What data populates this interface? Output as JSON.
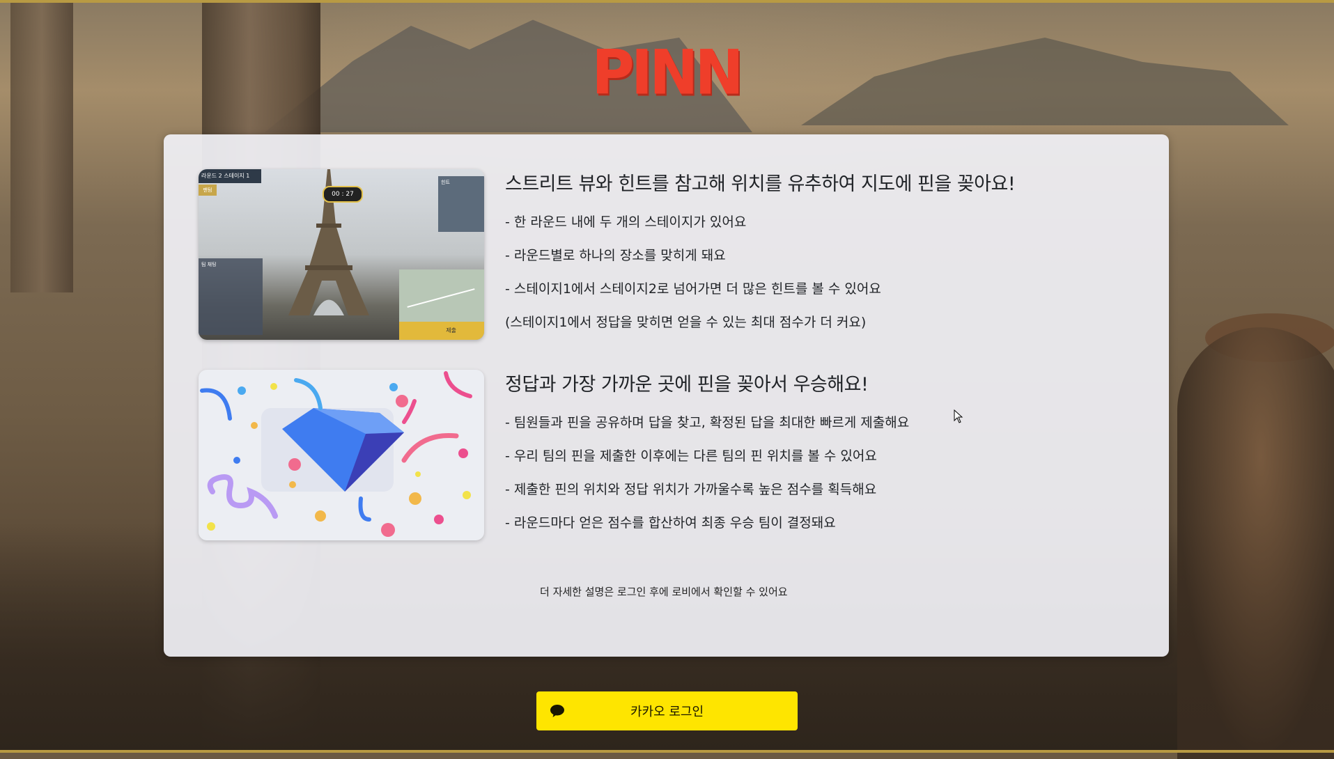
{
  "app": {
    "logo": "PINN"
  },
  "colors": {
    "brand_red": "#ef3e2a",
    "kakao_yellow": "#fee500",
    "frame_gold": "#b89a43"
  },
  "section1": {
    "title": "스트리트 뷰와 힌트를 참고해 위치를 유추하여 지도에 핀을 꽂아요!",
    "lines": [
      "- 한 라운드 내에 두 개의 스테이지가 있어요",
      "- 라운드별로 하나의 장소를 맞히게 돼요",
      "- 스테이지1에서 스테이지2로 넘어가면 더 많은 힌트를 볼 수 있어요",
      "(스테이지1에서 정답을 맞히면 얻을 수 있는 최대 점수가 더 커요)"
    ],
    "screenshot": {
      "round_label": "라운드 2  스테이지 1",
      "sub_label": "팬텀",
      "timer": "00 : 27",
      "hint_title": "힌트",
      "team_title": "팀 채팅",
      "submit_label": "제출"
    }
  },
  "section2": {
    "title": "정답과 가장 가까운 곳에 핀을 꽂아서 우승해요!",
    "lines": [
      "- 팀원들과 핀을 공유하며 답을 찾고, 확정된 답을 최대한 빠르게 제출해요",
      "- 우리 팀의 핀을 제출한 이후에는 다른 팀의 핀 위치를 볼 수 있어요",
      "- 제출한 핀의 위치와 정답 위치가 가까울수록 높은 점수를 획득해요",
      "- 라운드마다 얻은 점수를 합산하여 최종 우승 팀이 결정돼요"
    ]
  },
  "note": "더 자세한 설명은 로그인 후에 로비에서 확인할 수 있어요",
  "login": {
    "kakao_label": "카카오 로그인",
    "icon": "chat-bubble-icon"
  }
}
